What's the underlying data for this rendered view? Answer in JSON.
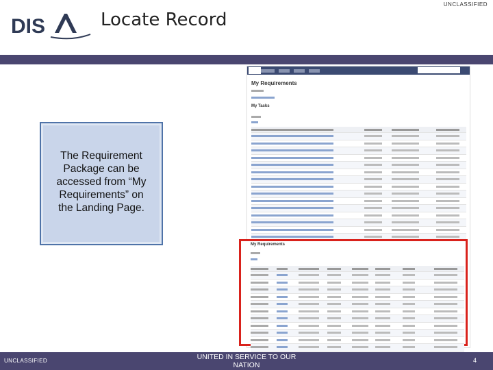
{
  "classification_top": "UNCLASSIFIED",
  "classification_bottom": "UNCLASSIFIED",
  "slide_title": "Locate Record",
  "logo_text": "DISA",
  "callout": {
    "line1": "The Requirement",
    "line2": "Package can be",
    "line3": "accessed from “My",
    "line4": "Requirements” on",
    "line5": "the Landing Page."
  },
  "footer_motto": "UNITED IN SERVICE TO OUR NATION",
  "page_number": "4",
  "screenshot": {
    "page_heading": "My Requirements",
    "section_tasks": "My Tasks",
    "section_reqs": "My Requirements"
  },
  "colors": {
    "band": "#4a4670",
    "callout_fill": "#c9d5ea",
    "callout_border": "#4f73a8",
    "highlight": "#d9221c"
  }
}
